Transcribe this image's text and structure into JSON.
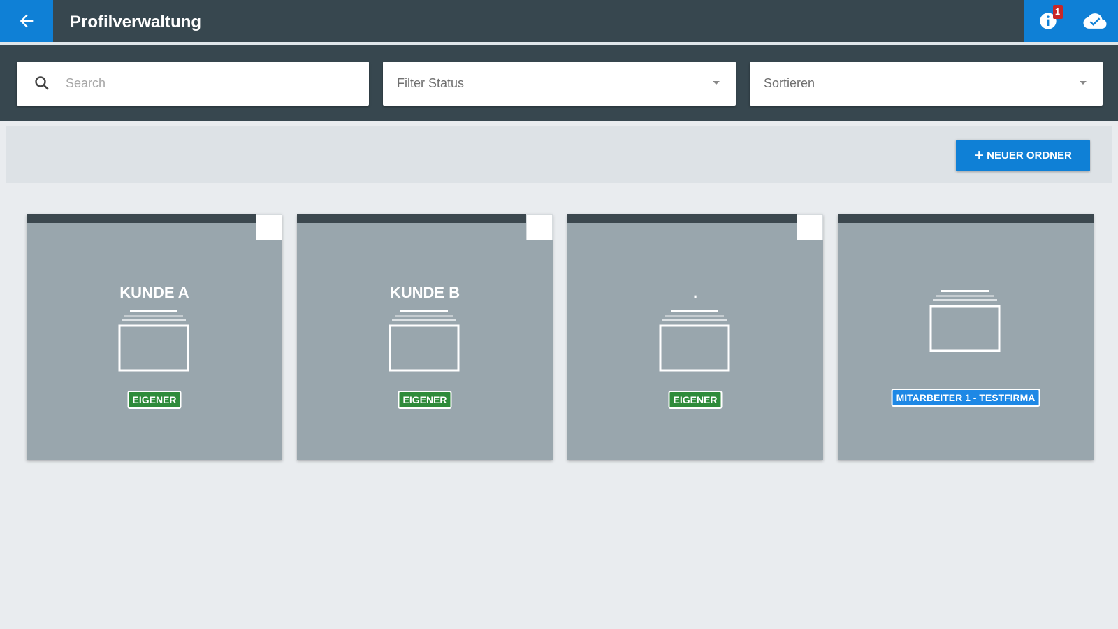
{
  "header": {
    "title": "Profilverwaltung",
    "notification_count": "1",
    "accent_color": "#0f80d6",
    "bar_color": "#37474f"
  },
  "filters": {
    "search_placeholder": "Search",
    "filter_status_label": "Filter Status",
    "sort_label": "Sortieren"
  },
  "actions": {
    "new_folder_label": "NEUER ORDNER"
  },
  "folders": [
    {
      "title": "KUNDE A",
      "tag": "EIGENER",
      "tag_type": "owner",
      "selectable": true
    },
    {
      "title": "KUNDE B",
      "tag": "EIGENER",
      "tag_type": "owner",
      "selectable": true
    },
    {
      "title": ".",
      "tag": "EIGENER",
      "tag_type": "owner",
      "selectable": true
    },
    {
      "title": "",
      "tag": "MITARBEITER 1 - TESTFIRMA",
      "tag_type": "staff",
      "selectable": false
    }
  ],
  "icons": [
    "back-arrow-icon",
    "info-icon",
    "cloud-icon",
    "search-icon",
    "chevron-down-icon",
    "folder-icon",
    "plus-icon"
  ]
}
